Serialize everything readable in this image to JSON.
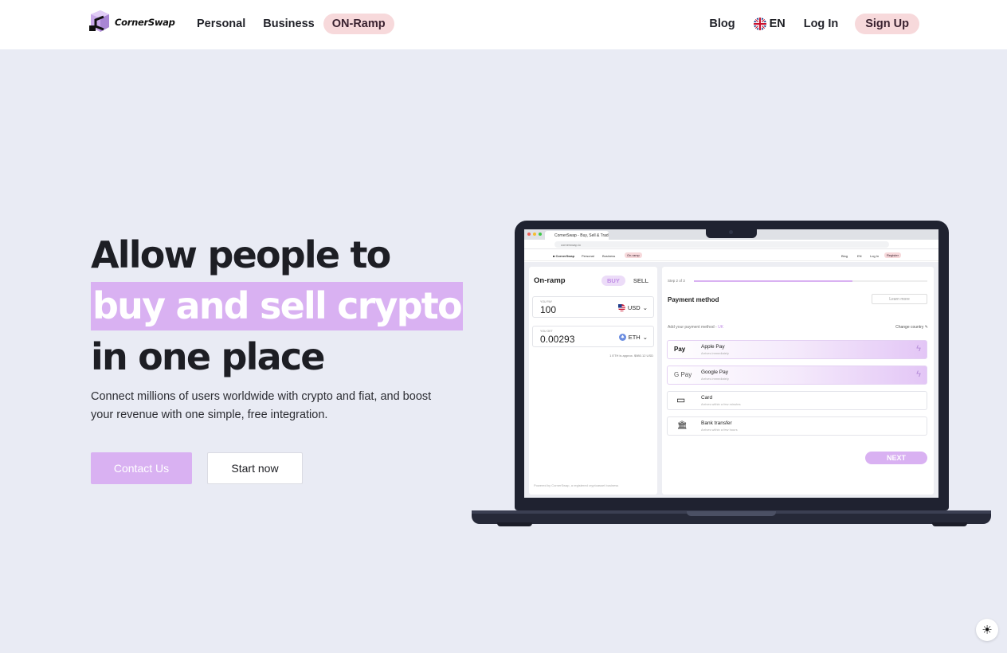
{
  "nav": {
    "brand": "CornerSwap",
    "links": [
      {
        "label": "Personal"
      },
      {
        "label": "Business"
      },
      {
        "label": "ON-Ramp",
        "active": true
      }
    ],
    "blog": "Blog",
    "language": "EN",
    "login": "Log In",
    "signup": "Sign Up"
  },
  "hero": {
    "title_line1": "Allow people to",
    "title_highlight": "buy and sell crypto",
    "title_line3": "in one place",
    "subtitle": "Connect millions of users worldwide with crypto and fiat, and boost your revenue with one simple, free integration.",
    "contact_button": "Contact Us",
    "start_button": "Start now"
  },
  "colors": {
    "accent": "#d9b1f2",
    "pill": "#f7d9db",
    "background": "#e9ebf4",
    "laptop": "#1f2230"
  },
  "widget": {
    "browser_tab": "CornerSwap - Buy, Sell & Trade...",
    "url": "cornerswap.io",
    "site_nav": [
      "Personal",
      "Business",
      "On-ramp"
    ],
    "site_nav_right": [
      "Blog",
      "EN",
      "Log In",
      "Register"
    ],
    "left": {
      "title": "On-ramp",
      "buy": "BUY",
      "sell": "SELL",
      "pay_label": "YOU PAY",
      "pay_value": "100",
      "pay_currency": "USD",
      "get_label": "YOU GET",
      "get_value": "0.00293",
      "get_currency": "ETH",
      "rate": "1 ETH is approx. $980.12 USD",
      "powered": "Powered by CornerSwap, a registered cryptoasset business"
    },
    "right": {
      "step": "Step 2 of 3",
      "progress": 0.68,
      "title": "Payment method",
      "learn_more": "Learn more",
      "hint": "Add your payment method -",
      "hint_country": "UK",
      "change_country": "Change country",
      "options": [
        {
          "icon": "apple-pay-icon",
          "mark": " Pay",
          "name": "Apple Pay",
          "sub": "Arrives immediately",
          "fast": true
        },
        {
          "icon": "google-pay-icon",
          "mark": "G Pay",
          "name": "Google Pay",
          "sub": "Arrives immediately",
          "fast": true
        },
        {
          "icon": "card-icon",
          "mark": "▭",
          "name": "Card",
          "sub": "Arrives within a few minutes",
          "fast": false
        },
        {
          "icon": "bank-icon",
          "mark": "🏛",
          "name": "Bank transfer",
          "sub": "Arrives within a few hours",
          "fast": false
        }
      ],
      "next": "NEXT"
    }
  },
  "theme_toggle_icon": "sun-icon"
}
